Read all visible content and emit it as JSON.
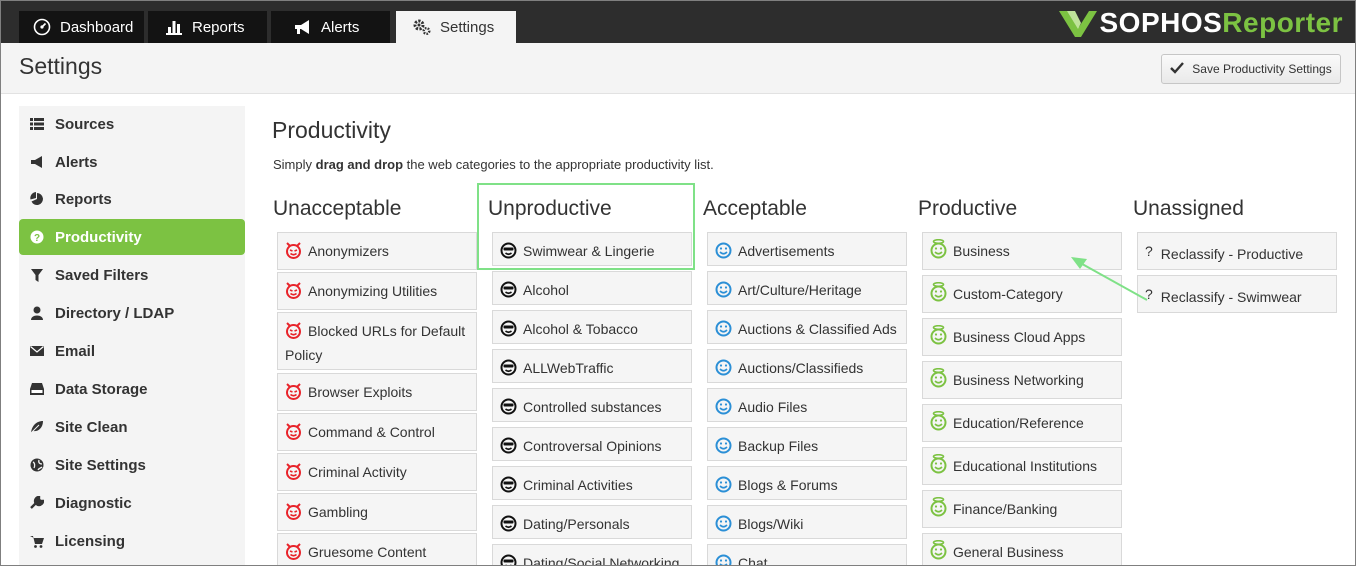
{
  "tabs": [
    {
      "label": "Dashboard",
      "icon": "dashboard-icon"
    },
    {
      "label": "Reports",
      "icon": "bar-chart-icon"
    },
    {
      "label": "Alerts",
      "icon": "megaphone-icon"
    },
    {
      "label": "Settings",
      "icon": "gears-icon",
      "active": true
    }
  ],
  "logo": {
    "part1": "SOPHOS",
    "part2": "Reporter",
    "accent": "#7cc242"
  },
  "header": {
    "title": "Settings",
    "save_label": "Save Productivity Settings"
  },
  "sidebar": {
    "items": [
      {
        "label": "Sources",
        "icon": "list-icon"
      },
      {
        "label": "Alerts",
        "icon": "megaphone-icon"
      },
      {
        "label": "Reports",
        "icon": "pie-chart-icon"
      },
      {
        "label": "Productivity",
        "icon": "question-circle-icon",
        "active": true
      },
      {
        "label": "Saved Filters",
        "icon": "filter-icon"
      },
      {
        "label": "Directory / LDAP",
        "icon": "user-icon"
      },
      {
        "label": "Email",
        "icon": "envelope-icon"
      },
      {
        "label": "Data Storage",
        "icon": "hdd-icon"
      },
      {
        "label": "Site Clean",
        "icon": "leaf-icon"
      },
      {
        "label": "Site Settings",
        "icon": "globe-icon"
      },
      {
        "label": "Diagnostic",
        "icon": "wrench-icon"
      },
      {
        "label": "Licensing",
        "icon": "cart-icon"
      }
    ]
  },
  "main": {
    "title": "Productivity",
    "instructions": {
      "before": "Simply ",
      "bold": "drag and drop",
      "after": " the web categories to the appropriate productivity list."
    },
    "columns": [
      {
        "heading": "Unacceptable",
        "icon": "devil-face-icon",
        "items": [
          "Anonymizers",
          "Anonymizing Utilities",
          "Blocked URLs for Default Policy",
          "Browser Exploits",
          "Command & Control",
          "Criminal Activity",
          "Gambling",
          "Gruesome Content"
        ]
      },
      {
        "heading": "Unproductive",
        "icon": "sunglasses-face-icon",
        "items": [
          "Swimwear & Lingerie",
          "Alcohol",
          "Alcohol & Tobacco",
          "ALLWebTraffic",
          "Controlled substances",
          "Controversal Opinions",
          "Criminal Activities",
          "Dating/Personals",
          "Dating/Social Networking"
        ]
      },
      {
        "heading": "Acceptable",
        "icon": "smiley-face-icon",
        "items": [
          "Advertisements",
          "Art/Culture/Heritage",
          "Auctions & Classified Ads",
          "Auctions/Classifieds",
          "Audio Files",
          "Backup Files",
          "Blogs & Forums",
          "Blogs/Wiki",
          "Chat"
        ]
      },
      {
        "heading": "Productive",
        "icon": "angel-face-icon",
        "items": [
          "Business",
          "Custom-Category",
          "Business Cloud Apps",
          "Business Networking",
          "Education/Reference",
          "Educational Institutions",
          "Finance/Banking",
          "General Business"
        ]
      },
      {
        "heading": "Unassigned",
        "icon": "question-mark-icon",
        "items": [
          "Reclassify - Productive",
          "Reclassify - Swimwear"
        ]
      }
    ]
  },
  "colors": {
    "unacceptable": "#e8232a",
    "unproductive": "#111111",
    "acceptable": "#2b8fd6",
    "productive": "#7cc242",
    "highlight": "#7fe187"
  }
}
